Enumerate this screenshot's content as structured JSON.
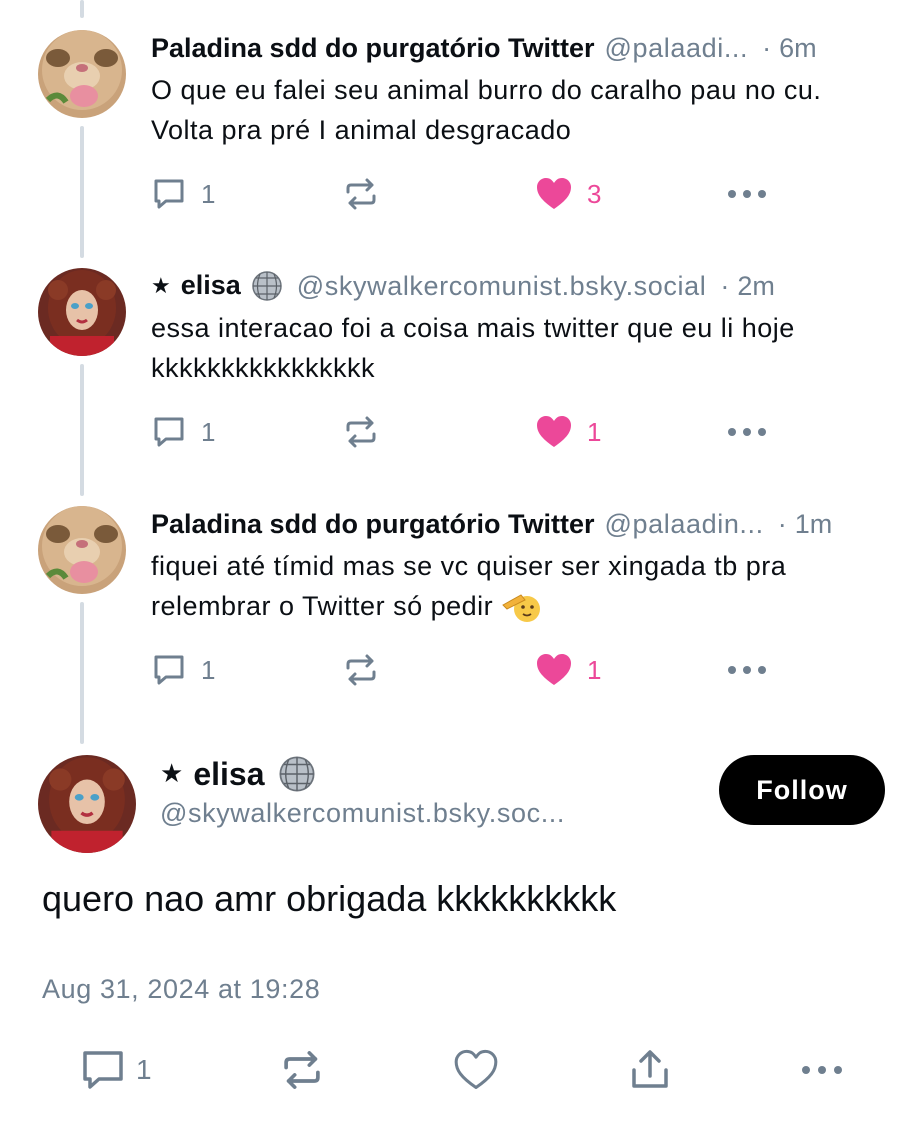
{
  "colors": {
    "text": "#0b0f14",
    "muted": "#6f7f8f",
    "like_pink": "#ec4899",
    "thread_line": "#d4dbe2",
    "follow_bg": "#000000"
  },
  "replies": [
    {
      "author_name": "Paladina sdd do purgatório Twitter",
      "handle": "@palaadi...",
      "separator": "·",
      "time": "6m",
      "avatar": "cat-avatar",
      "text": "O que eu falei seu animal burro do caralho pau no cu. Volta pra pré I animal desgracado",
      "reply_count": "1",
      "like_count": "3",
      "liked": true
    },
    {
      "author_name": "elisa",
      "name_prefix": "★",
      "name_suffix_icon": "disco-ball-icon",
      "handle": "@skywalkercomunist.bsky.social",
      "separator": "·",
      "time": "2m",
      "avatar": "woman-avatar",
      "text": "essa interacao foi a coisa mais twitter que eu li hoje kkkkkkkkkkkkkkkk",
      "reply_count": "1",
      "like_count": "1",
      "liked": true
    },
    {
      "author_name": "Paladina sdd do purgatório Twitter",
      "handle": "@palaadin...",
      "separator": "·",
      "time": "1m",
      "avatar": "cat-avatar",
      "text": "fiquei até tímid mas se vc quiser ser xingada tb pra relembrar o Twitter só pedir",
      "text_emoji": "saluting-face-icon",
      "reply_count": "1",
      "like_count": "1",
      "liked": true
    }
  ],
  "main_post": {
    "name_prefix": "★",
    "author_name": "elisa",
    "name_suffix_icon": "disco-ball-icon",
    "handle": "@skywalkercomunist.bsky.soc...",
    "follow_label": "Follow",
    "text": "quero nao amr obrigada kkkkkkkkkk",
    "date": "Aug 31, 2024 at 19:28",
    "reply_count": "1"
  }
}
